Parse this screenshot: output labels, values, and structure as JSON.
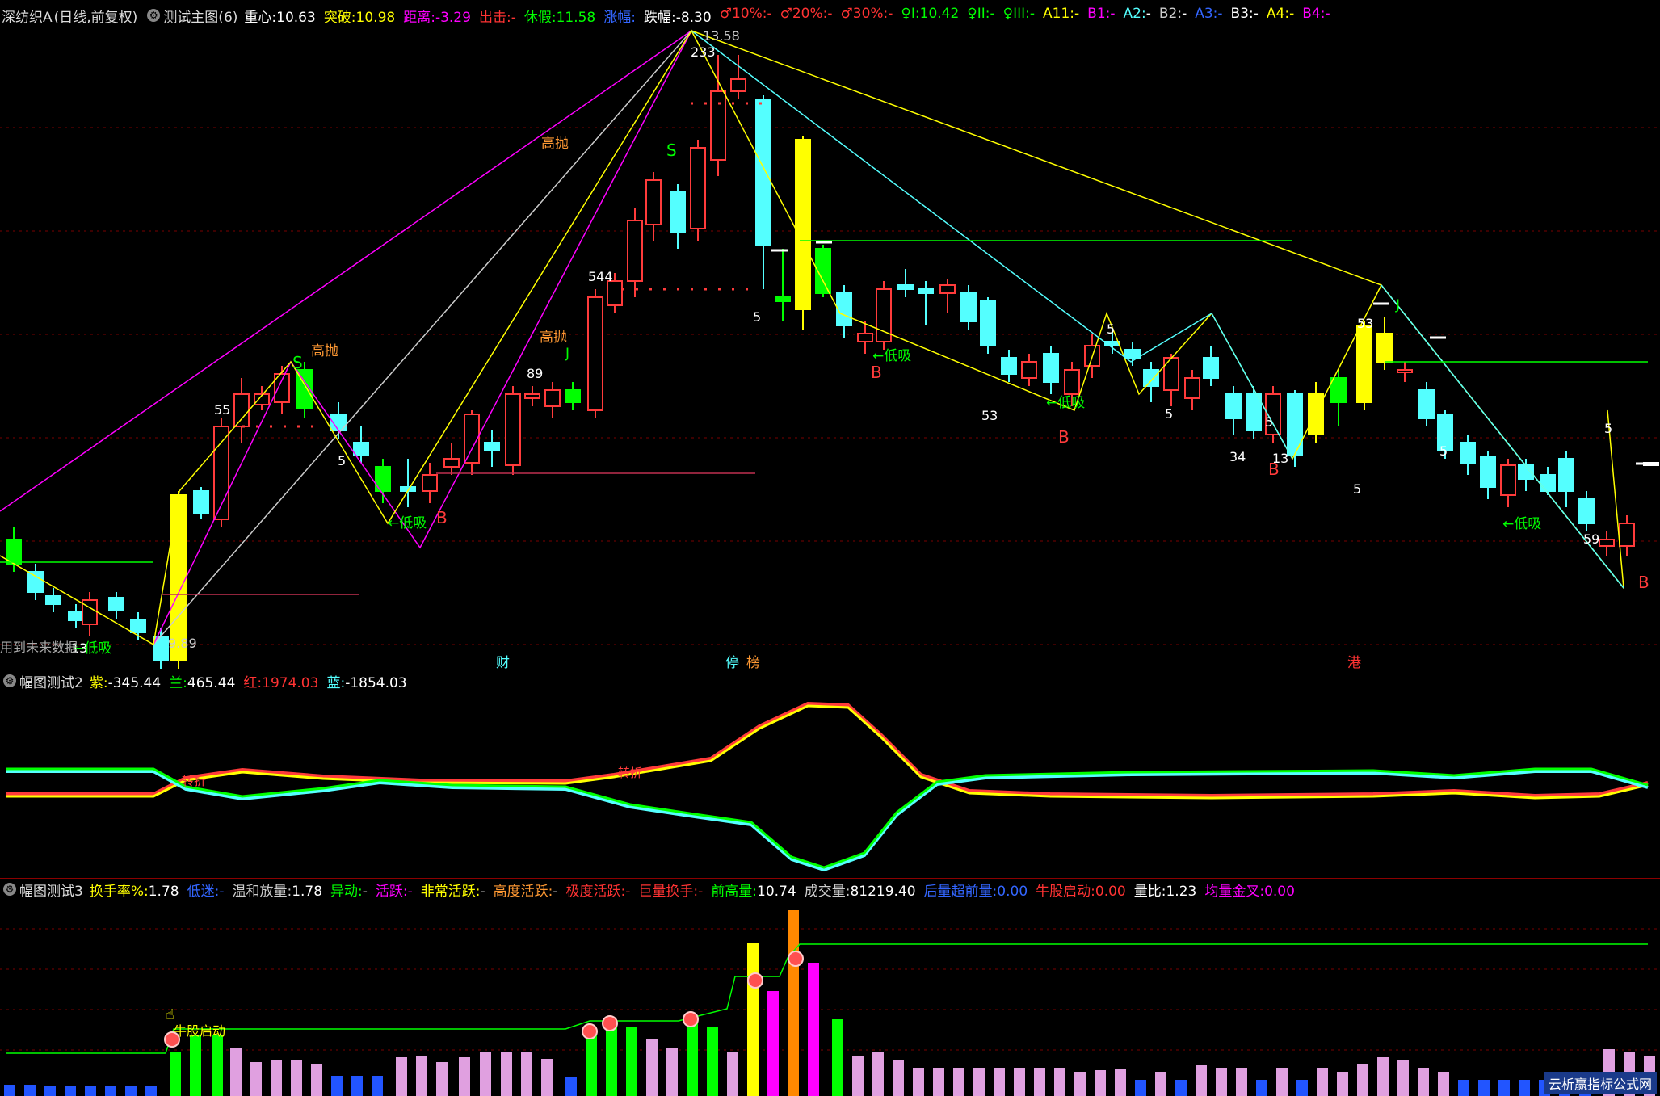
{
  "colors": {
    "up": "#ff3b3b",
    "down": "#54ffff",
    "yellow": "#ffff00",
    "green": "#00ff00",
    "magenta": "#ff00ff",
    "bg": "#000000",
    "grid": "#7a0000"
  },
  "main_header": {
    "stock": "深纺织A",
    "period": "(日线,前复权)",
    "indicator": "测试主图(6)",
    "items": [
      {
        "label": "重心:",
        "value": "10.63",
        "color": "#ffffff"
      },
      {
        "label": "突破:",
        "value": "10.98",
        "color": "#ffff00"
      },
      {
        "label": "距离:",
        "value": "-3.29",
        "color": "#ff00ff"
      },
      {
        "label": "出击:",
        "value": "-",
        "color": "#ff3333"
      },
      {
        "label": "休假:",
        "value": "11.58",
        "color": "#00ff00"
      },
      {
        "label": "涨幅:",
        "value": "",
        "color": "#3366ff"
      },
      {
        "label": "跌幅:",
        "value": "-8.30",
        "color": "#ffffff"
      },
      {
        "label": "♂10%:",
        "value": "-",
        "color": "#ff3333"
      },
      {
        "label": "♂20%:",
        "value": "-",
        "color": "#ff3333"
      },
      {
        "label": "♂30%:",
        "value": "-",
        "color": "#ff3333"
      },
      {
        "label": "♀I:",
        "value": "10.42",
        "color": "#00ff00"
      },
      {
        "label": "♀II:",
        "value": "-",
        "color": "#00ff00"
      },
      {
        "label": "♀III:",
        "value": "-",
        "color": "#00ff00"
      },
      {
        "label": "A11:",
        "value": "-",
        "color": "#ffff00"
      },
      {
        "label": "B1:",
        "value": "-",
        "color": "#ff00ff"
      },
      {
        "label": "A2:",
        "value": "-",
        "color": "#54ffff"
      },
      {
        "label": "B2:",
        "value": "-",
        "color": "#cccccc"
      },
      {
        "label": "A3:",
        "value": "-",
        "color": "#3366ff"
      },
      {
        "label": "B3:",
        "value": "-",
        "color": "#ffffff"
      },
      {
        "label": "A4:",
        "value": "-",
        "color": "#ffff00"
      },
      {
        "label": "B4:",
        "value": "-",
        "color": "#ff00ff"
      }
    ]
  },
  "price_labels": {
    "high": "13.58",
    "low": "9.89"
  },
  "annotations": {
    "sell_high": "高抛",
    "buy_low": "←低吸",
    "buy_low_plain": "低吸",
    "s_mark": "S",
    "b_mark": "B",
    "j_mark": "J",
    "future_note": "用到未来数据",
    "numbers": [
      "13",
      "55",
      "5",
      "89",
      "544",
      "233",
      "5",
      "5",
      "53",
      "5",
      "5",
      "34",
      "13",
      "5",
      "53",
      "5",
      "59",
      "5"
    ]
  },
  "events": [
    {
      "label": "财",
      "color": "#54ffff"
    },
    {
      "label": "停",
      "color": "#54ffff"
    },
    {
      "label": "榜",
      "color": "#ff9933"
    },
    {
      "label": "港",
      "color": "#ff3333"
    }
  ],
  "ind2_header": {
    "name": "幅图测试2",
    "items": [
      {
        "label": "紫:",
        "value": "-345.44",
        "color": "#ffff00"
      },
      {
        "label": "兰:",
        "value": "465.44",
        "color": "#00ff00"
      },
      {
        "label": "红:",
        "value": "1974.03",
        "color": "#ff3333"
      },
      {
        "label": "蓝:",
        "value": "-1854.03",
        "color": "#54ffff"
      }
    ],
    "inline_labels": [
      "转折",
      "转折"
    ]
  },
  "ind3_header": {
    "name": "幅图测试3",
    "items": [
      {
        "label": "换手率%:",
        "value": "1.78",
        "color": "#ffff00"
      },
      {
        "label": "低迷:",
        "value": "-",
        "color": "#3366ff"
      },
      {
        "label": "温和放量:",
        "value": "1.78",
        "color": "#cccccc"
      },
      {
        "label": "异动:",
        "value": "-",
        "color": "#00ff00"
      },
      {
        "label": "活跃:",
        "value": "-",
        "color": "#ff00ff"
      },
      {
        "label": "非常活跃:",
        "value": "-",
        "color": "#ffff00"
      },
      {
        "label": "高度活跃:",
        "value": "-",
        "color": "#ff9933"
      },
      {
        "label": "极度活跃:",
        "value": "-",
        "color": "#ff3333"
      },
      {
        "label": "巨量换手:",
        "value": "-",
        "color": "#ff3333"
      },
      {
        "label": "前高量:",
        "value": "10.74",
        "color": "#00ff00"
      },
      {
        "label": "成交量:",
        "value": "81219.40",
        "color": "#cccccc"
      },
      {
        "label": "后量超前量:",
        "value": "0.00",
        "color": "#3366ff"
      },
      {
        "label": "牛股启动:",
        "value": "0.00",
        "color": "#ff3333"
      },
      {
        "label": "量比:",
        "value": "1.23",
        "color": "#ffffff"
      },
      {
        "label": "均量金叉:",
        "value": "0.00",
        "color": "#ff00ff"
      }
    ],
    "bull_start_label": "牛股启动"
  },
  "watermark": "云析赢指标公式网"
}
